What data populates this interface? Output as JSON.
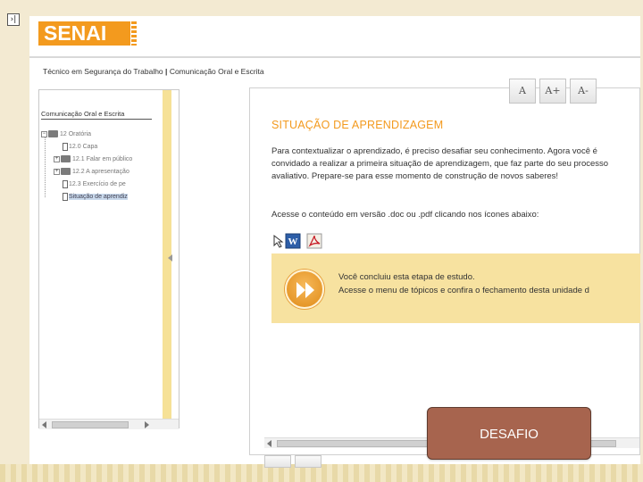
{
  "window": {
    "toggle_glyph": "›|"
  },
  "header": {
    "logo_text": "SENAI"
  },
  "breadcrumb": {
    "course": "Técnico em Segurança do Trabalho",
    "separator": "|",
    "unit": "Comunicação Oral e Escrita"
  },
  "tree": {
    "title": "Comunicação Oral e Escrita",
    "items": [
      {
        "label": "12 Oratória",
        "level": 0,
        "icon": "folder-icon",
        "expander": "−"
      },
      {
        "label": "12.0 Capa",
        "level": 1,
        "icon": "document-icon"
      },
      {
        "label": "12.1 Falar em público",
        "level": 1,
        "icon": "folder-icon",
        "expander": "+"
      },
      {
        "label": "12.2 A apresentação",
        "level": 1,
        "icon": "folder-icon",
        "expander": "+"
      },
      {
        "label": "12.3 Exercício de pe",
        "level": 1,
        "icon": "document-icon"
      },
      {
        "label": "Situação de aprendiz",
        "level": 1,
        "icon": "document-icon",
        "selected": true
      }
    ]
  },
  "font_controls": {
    "reset": "A",
    "increase": "A+",
    "decrease": "A-"
  },
  "content": {
    "heading": "SITUAÇÃO DE APRENDIZAGEM",
    "paragraph": "Para contextualizar o aprendizado, é preciso desafiar seu conhecimento. Agora você é convidado a realizar a primeira situação de aprendizagem, que faz parte do seu processo avaliativo. Prepare-se para esse momento de construção de novos saberes!",
    "access_text": "Acesse o conteúdo em versão .doc ou .pdf clicando nos ícones abaixo:",
    "file_icons": [
      "cursor-icon",
      "word-document-icon",
      "pdf-document-icon"
    ],
    "word_glyph": "W"
  },
  "notice": {
    "line1": "Você concluiu esta etapa de estudo.",
    "line2": "Acesse o menu de tópicos e confira o fechamento desta unidade d"
  },
  "overlay_button": {
    "label": "DESAFIO"
  },
  "colors": {
    "brand_orange": "#f39a1e",
    "panel_yellow": "#f6e197",
    "notice_yellow": "#f7e2a0",
    "desafio_brown": "#a7644e"
  }
}
